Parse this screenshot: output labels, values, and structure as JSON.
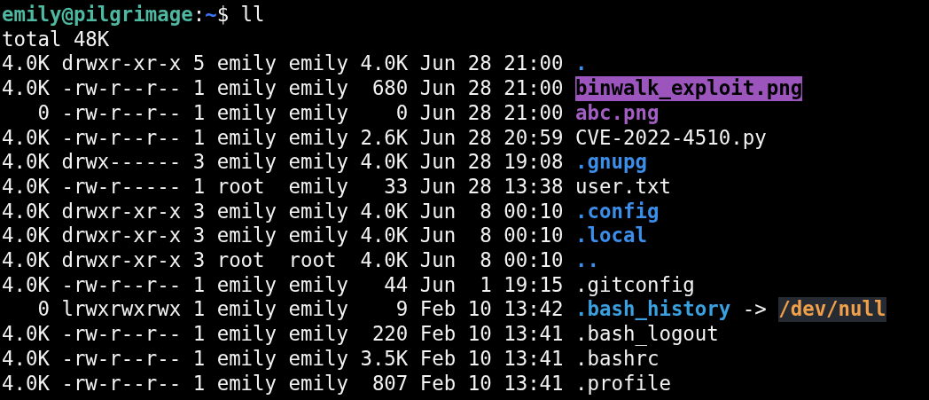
{
  "prompt": {
    "user_host": "emily@pilgrimage",
    "separator": ":",
    "path": "~",
    "symbol": "$",
    "command": "ll"
  },
  "total": "total 48K",
  "entries": [
    {
      "info": "4.0K drwxr-xr-x 5 emily emily 4.0K Jun 28 21:00",
      "name": ".",
      "kind": "directory"
    },
    {
      "info": "4.0K -rw-r--r-- 1 emily emily  680 Jun 28 21:00",
      "name": "binwalk_exploit.png",
      "kind": "image-highlight"
    },
    {
      "info": "   0 -rw-r--r-- 1 emily emily    0 Jun 28 21:00",
      "name": "abc.png",
      "kind": "image"
    },
    {
      "info": "4.0K -rw-r--r-- 1 emily emily 2.6K Jun 28 20:59",
      "name": "CVE-2022-4510.py",
      "kind": "file"
    },
    {
      "info": "4.0K drwx------ 3 emily emily 4.0K Jun 28 19:08",
      "name": ".gnupg",
      "kind": "directory"
    },
    {
      "info": "4.0K -rw-r----- 1 root  emily   33 Jun 28 13:38",
      "name": "user.txt",
      "kind": "file"
    },
    {
      "info": "4.0K drwxr-xr-x 3 emily emily 4.0K Jun  8 00:10",
      "name": ".config",
      "kind": "directory"
    },
    {
      "info": "4.0K drwxr-xr-x 3 emily emily 4.0K Jun  8 00:10",
      "name": ".local",
      "kind": "directory"
    },
    {
      "info": "4.0K drwxr-xr-x 3 root  root  4.0K Jun  8 00:10",
      "name": "..",
      "kind": "directory"
    },
    {
      "info": "4.0K -rw-r--r-- 1 emily emily   44 Jun  1 19:15",
      "name": ".gitconfig",
      "kind": "file"
    },
    {
      "info": "   0 lrwxrwxrwx 1 emily emily    9 Feb 10 13:42",
      "name": ".bash_history",
      "kind": "symlink",
      "arrow": "->",
      "target": "/dev/null"
    },
    {
      "info": "4.0K -rw-r--r-- 1 emily emily  220 Feb 10 13:41",
      "name": ".bash_logout",
      "kind": "file"
    },
    {
      "info": "4.0K -rw-r--r-- 1 emily emily 3.5K Feb 10 13:41",
      "name": ".bashrc",
      "kind": "file"
    },
    {
      "info": "4.0K -rw-r--r-- 1 emily emily  807 Feb 10 13:41",
      "name": ".profile",
      "kind": "file"
    }
  ]
}
